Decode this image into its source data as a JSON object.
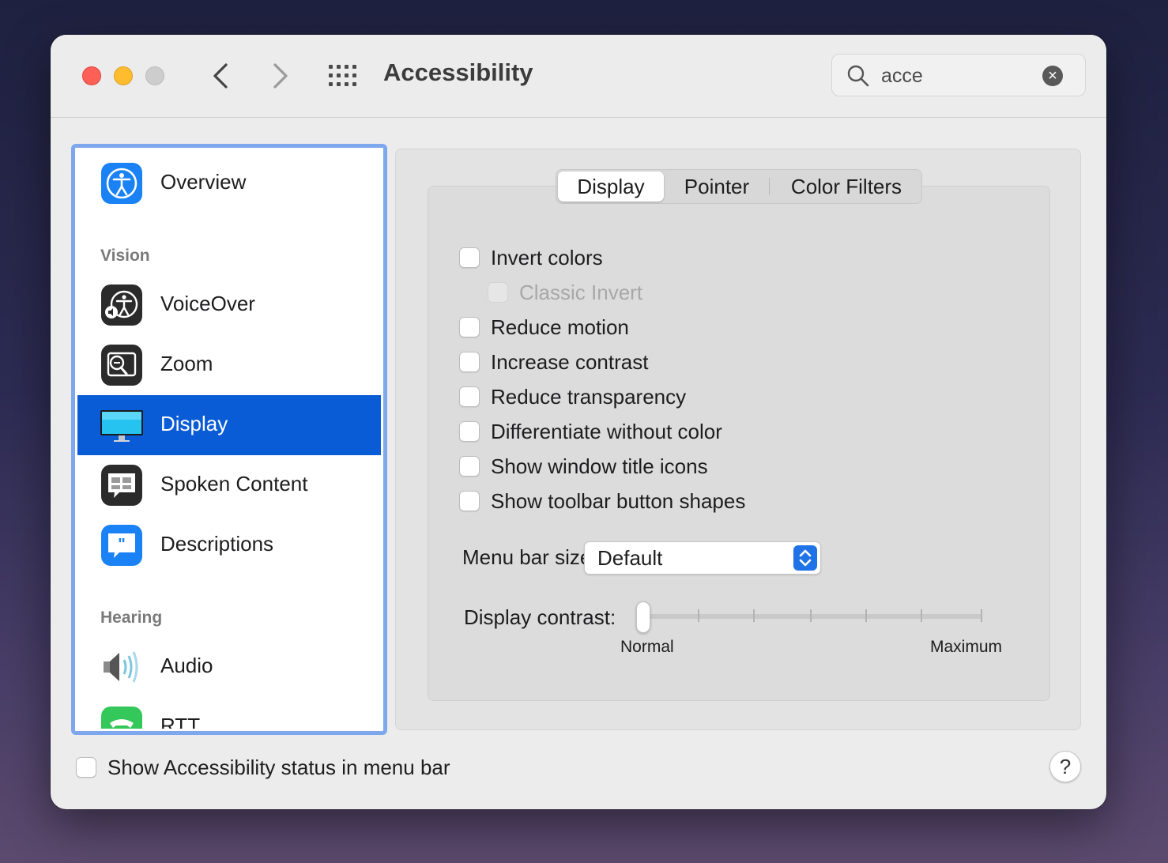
{
  "window": {
    "title": "Accessibility"
  },
  "search": {
    "value": "acce",
    "clear_icon": "clear-icon"
  },
  "sidebar": {
    "items": [
      {
        "label": "Overview",
        "icon": "accessibility-icon"
      },
      {
        "label": "VoiceOver",
        "icon": "voiceover-icon"
      },
      {
        "label": "Zoom",
        "icon": "zoom-icon"
      },
      {
        "label": "Display",
        "icon": "display-icon"
      },
      {
        "label": "Spoken Content",
        "icon": "spoken-content-icon"
      },
      {
        "label": "Descriptions",
        "icon": "descriptions-icon"
      },
      {
        "label": "Audio",
        "icon": "speaker-icon"
      },
      {
        "label": "RTT",
        "icon": "rtt-icon"
      }
    ],
    "headings": [
      "Vision",
      "Hearing"
    ],
    "selected": "Display"
  },
  "tabs": [
    {
      "label": "Display"
    },
    {
      "label": "Pointer"
    },
    {
      "label": "Color Filters"
    }
  ],
  "active_tab": "Display",
  "options": [
    {
      "label": "Invert colors",
      "checked": false,
      "enabled": true
    },
    {
      "label": "Classic Invert",
      "checked": false,
      "enabled": false
    },
    {
      "label": "Reduce motion",
      "checked": false,
      "enabled": true
    },
    {
      "label": "Increase contrast",
      "checked": false,
      "enabled": true
    },
    {
      "label": "Reduce transparency",
      "checked": false,
      "enabled": true
    },
    {
      "label": "Differentiate without color",
      "checked": false,
      "enabled": true
    },
    {
      "label": "Show window title icons",
      "checked": false,
      "enabled": true
    },
    {
      "label": "Show toolbar button shapes",
      "checked": false,
      "enabled": true
    }
  ],
  "menu_bar_size": {
    "label": "Menu bar size:",
    "value": "Default"
  },
  "display_contrast": {
    "label": "Display contrast:",
    "min_label": "Normal",
    "max_label": "Maximum",
    "level": 0
  },
  "footer": {
    "status_checkbox_label": "Show Accessibility status in menu bar",
    "status_checked": false,
    "help_label": "?"
  },
  "colors": {
    "selection": "#0a5bd6",
    "focus_ring": "#7ea7ee",
    "accent": "#1f73e6"
  }
}
